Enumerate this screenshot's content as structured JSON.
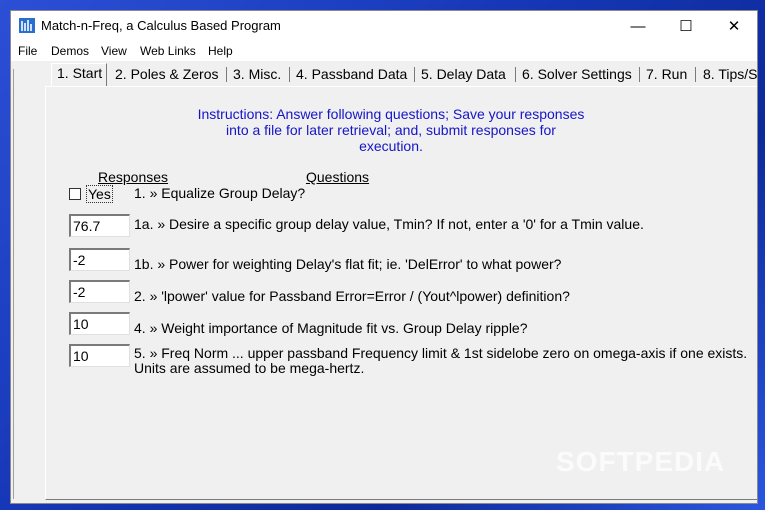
{
  "window": {
    "title": "Match-n-Freq, a Calculus Based Program",
    "controls": {
      "minimize": "—",
      "maximize": "☐",
      "close": "✕"
    }
  },
  "menu": [
    "File",
    "Demos",
    "View",
    "Web Links",
    "Help"
  ],
  "tabs": [
    "1. Start",
    "2. Poles & Zeros",
    "3. Misc.",
    "4. Passband Data",
    "5. Delay Data",
    "6. Solver Settings",
    "7. Run",
    "8. Tips/S"
  ],
  "instructions": [
    "Instructions: Answer following questions; Save your responses",
    "into a file for later retrieval; and, submit responses for",
    "execution."
  ],
  "headers": {
    "responses": "Responses",
    "questions": "Questions"
  },
  "q1": {
    "checkbox_label": "Yes",
    "checked": false,
    "text": "1. » Equalize Group Delay?"
  },
  "q1a": {
    "value": "76.7",
    "text": "1a. » Desire a specific group delay value, Tmin?  If not, enter a '0' for a Tmin value."
  },
  "q1b": {
    "value": "-2",
    "text": "1b. » Power for weighting Delay's flat fit; ie. 'DelError' to what power?"
  },
  "q2": {
    "value": "-2",
    "text": "2. » 'lpower' value for Passband Error=Error / (Yout^lpower) definition?"
  },
  "q4": {
    "value": "10",
    "text": "4. » Weight importance of Magnitude fit vs. Group Delay ripple?"
  },
  "q5": {
    "value": "10",
    "text_line1": "5. » Freq Norm ... upper passband Frequency limit & 1st sidelobe zero on omega-axis if one exists.",
    "text_line2": "Units are assumed to be mega-hertz."
  },
  "watermark": "SOFTPEDIA"
}
